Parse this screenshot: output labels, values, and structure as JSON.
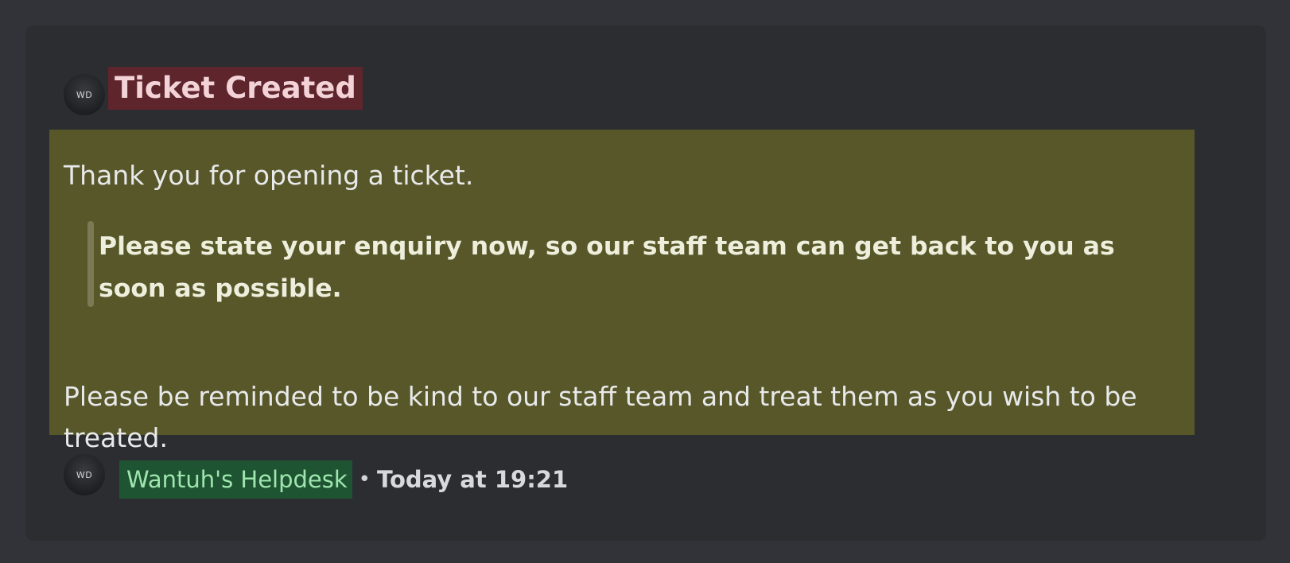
{
  "colors": {
    "background": "#313338",
    "embed_background": "#2b2d31",
    "title_highlight": "#5e252c",
    "description_highlight": "#575729",
    "footer_name_highlight": "#1f5433"
  },
  "embed": {
    "author_avatar": {
      "initials": "WD",
      "icon": "avatar-icon"
    },
    "title": "Ticket Created",
    "description": {
      "line1": "Thank you for opening a ticket.",
      "quote": "Please state your enquiry now, so our staff team can get back to you as soon as possible.",
      "line3a": "Please be reminded to be kind to our staff team and treat them as you wish to be",
      "line3b": "treated."
    },
    "footer": {
      "avatar_initials": "WD",
      "name": "Wantuh's Helpdesk",
      "separator": "•",
      "timestamp": "Today at 19:21"
    }
  }
}
